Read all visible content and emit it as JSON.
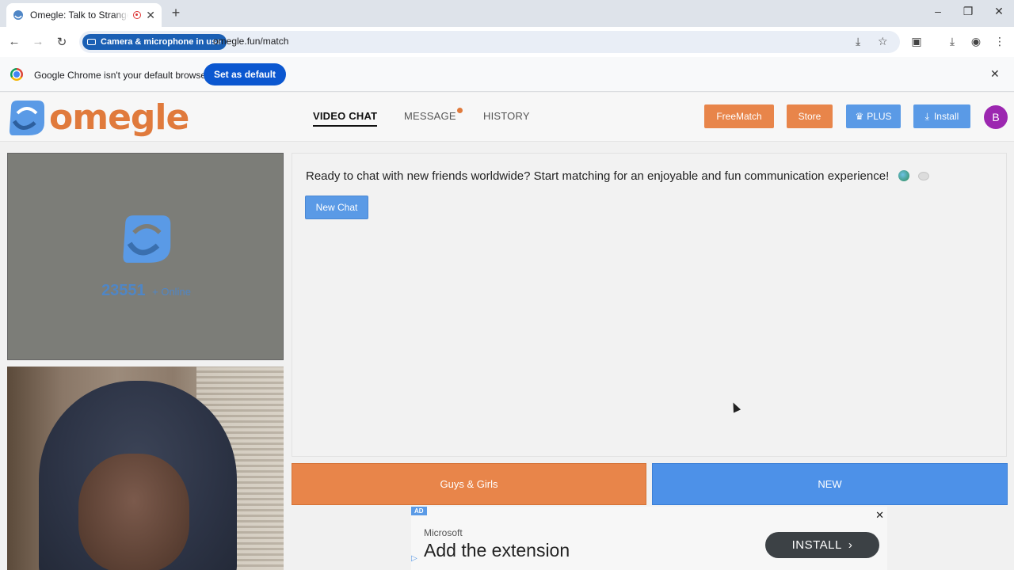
{
  "browser": {
    "tab_title": "Omegle: Talk to Strangers with Video",
    "tab_close_icon": "close-icon",
    "new_tab_icon": "plus-icon",
    "window_controls": {
      "minimize": "minimize-icon",
      "restore": "restore-icon",
      "close": "close-icon"
    },
    "camera_chip": "Camera & microphone in use",
    "url": "omegle.fun/match",
    "infobar_text": "Google Chrome isn't your default browser",
    "set_default_label": "Set as default"
  },
  "site": {
    "logo_text": "omegle",
    "nav": [
      {
        "label": "VIDEO CHAT",
        "active": true
      },
      {
        "label": "MESSAGE",
        "has_notification": true
      },
      {
        "label": "HISTORY"
      }
    ],
    "header_buttons": {
      "freematch": "FreeMatch",
      "store": "Store",
      "plus": "PLUS",
      "install": "Install"
    },
    "avatar_initial": "B",
    "colors": {
      "orange": "#e8854a",
      "blue": "#5a9ae6",
      "avatar": "#9c27b0"
    }
  },
  "main": {
    "online_count": "23551",
    "online_label": "+ Online",
    "chat_message": "Ready to chat with new friends worldwide? Start matching for an enjoyable and fun communication experience!",
    "new_chat_label": "New Chat",
    "gender_label": "Guys & Girls",
    "new_label": "NEW"
  },
  "ad": {
    "badge": "AD",
    "brand": "Microsoft",
    "headline": "Add the extension",
    "cta": "INSTALL"
  }
}
